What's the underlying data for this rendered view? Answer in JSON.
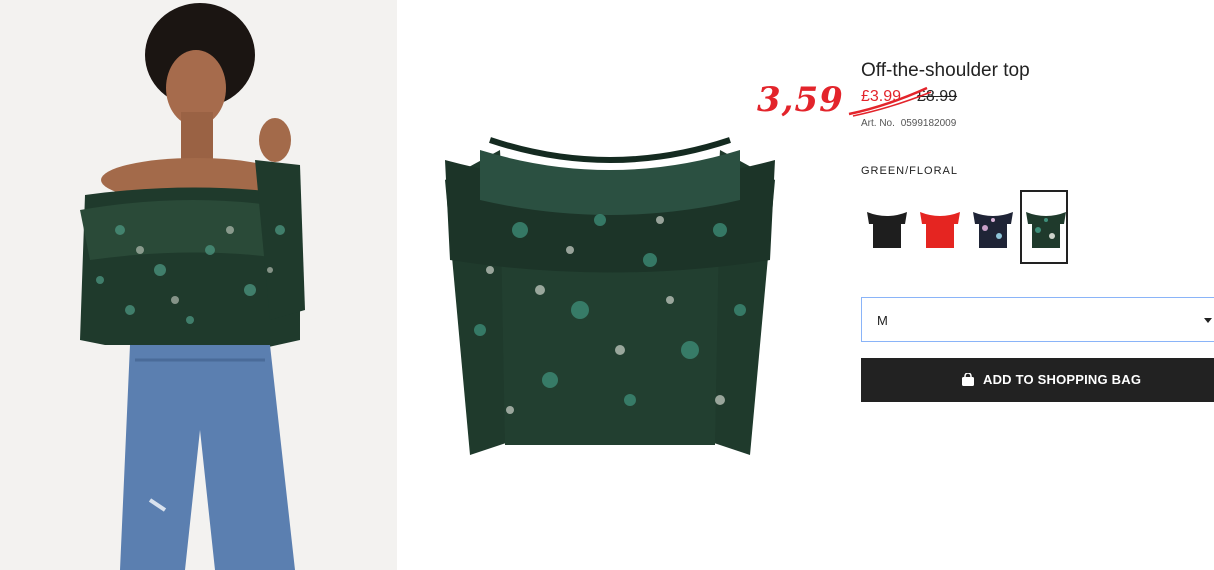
{
  "product": {
    "title": "Off-the-shoulder top",
    "promo_price": "3,59",
    "sale_price": "£3.99",
    "original_price": "£8.99",
    "article_label": "Art. No.",
    "article_number": "0599182009",
    "color_name": "GREEN/FLORAL"
  },
  "swatches": [
    {
      "color": "#1e1e1e",
      "selected": false
    },
    {
      "color": "#e52521",
      "selected": false
    },
    {
      "color": "#1f2436",
      "selected": false
    },
    {
      "color": "#1f3a2c",
      "selected": true
    }
  ],
  "size_select": {
    "value": "M"
  },
  "cart": {
    "button_label": "ADD TO SHOPPING BAG"
  },
  "colors": {
    "promo": "#e3242b",
    "button_bg": "#222222",
    "select_border": "#8ab4f8"
  }
}
